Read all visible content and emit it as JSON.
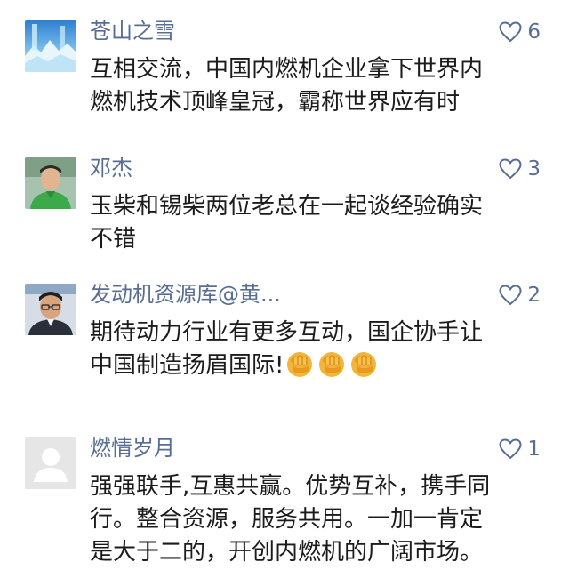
{
  "comments": [
    {
      "name": "苍山之雪",
      "likes": "6",
      "lines": [
        "互相交流，中国内燃机企业拿下世界内",
        "燃机技术顶峰皇冠，霸称世界应有时"
      ],
      "avatar_icon": "snowy-landscape-avatar"
    },
    {
      "name": "邓杰",
      "likes": "3",
      "lines": [
        "玉柴和锡柴两位老总在一起谈经验确实",
        "不错"
      ],
      "avatar_icon": "man-green-shirt-avatar"
    },
    {
      "name": "发动机资源库@黄...",
      "likes": "2",
      "lines": [
        "期待动力行业有更多互动，国企协手让",
        "中国制造扬眉国际!"
      ],
      "emoji": [
        "fist-emoji",
        "fist-emoji",
        "fist-emoji"
      ],
      "avatar_icon": "man-glasses-avatar"
    },
    {
      "name": "燃情岁月",
      "likes": "1",
      "lines": [
        "强强联手,互惠共赢。优势互补，携手同",
        "行。整合资源，服务共用。一加一肯定",
        "是大于二的，开创内燃机的广阔市场。"
      ],
      "avatar_icon": "default-user-avatar"
    }
  ],
  "colors": {
    "name": "#586d94",
    "text": "#1b1b1b",
    "like": "#586d94",
    "background": "#ffffff"
  }
}
